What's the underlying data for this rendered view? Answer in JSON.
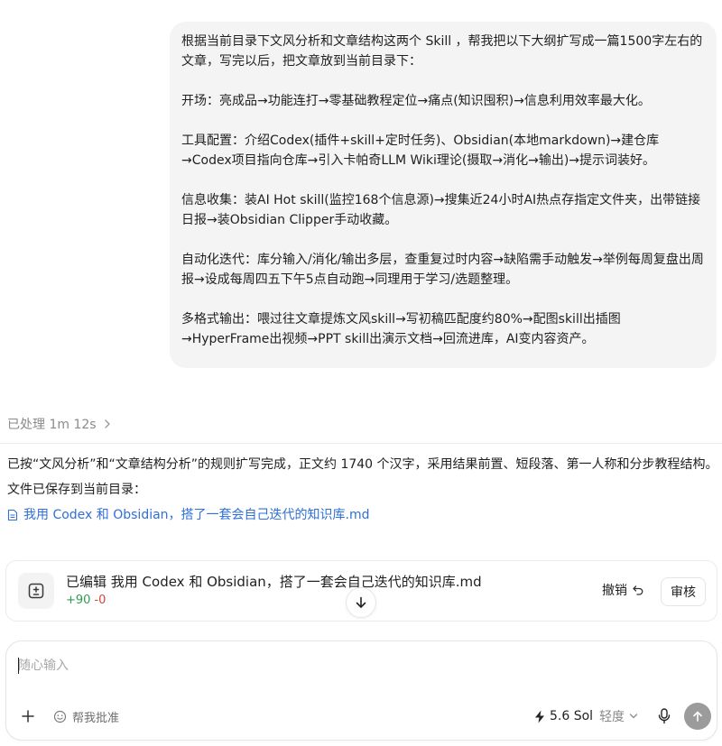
{
  "user_message": {
    "paragraphs": [
      "根据当前目录下文风分析和文章结构这两个 Skill ，帮我把以下大纲扩写成一篇1500字左右的文章，写完以后，把文章放到当前目录下：",
      "开场：亮成品→功能连打→零基础教程定位→痛点(知识囤积)→信息利用效率最大化。",
      "工具配置：介绍Codex(插件+skill+定时任务)、Obsidian(本地markdown)→建仓库→Codex项目指向仓库→引入卡帕奇LLM Wiki理论(摄取→消化→输出)→提示词装好。",
      "信息收集：装AI Hot skill(监控168个信息源)→搜集近24小时AI热点存指定文件夹，出带链接日报→装Obsidian Clipper手动收藏。",
      "自动化迭代：库分输入/消化/输出多层，查重复过时内容→缺陷需手动触发→举例每周复盘出周报→设成每周四五下午5点自动跑→同理用于学习/选题整理。",
      "多格式输出：喂过往文章提炼文风skill→写初稿匹配度约80%→配图skill出插图→HyperFrame出视频→PPT skill出演示文档→回流进库，AI变内容资产。"
    ]
  },
  "processing": {
    "label": "已处理 1m 12s"
  },
  "assistant_reply": {
    "summary": "已按“文风分析”和“文章结构分析”的规则扩写完成，正文约 1740 个汉字，采用结果前置、短段落、第一人称和分步教程结构。",
    "saved_note": "文件已保存到当前目录：",
    "file_name": "我用 Codex 和 Obsidian，搭了一套会自己迭代的知识库.md"
  },
  "edit_card": {
    "title": "已编辑 我用 Codex 和 Obsidian，搭了一套会自己迭代的知识库.md",
    "additions": "+90",
    "deletions": "-0",
    "undo_label": "撤销",
    "review_label": "审核"
  },
  "composer": {
    "placeholder": "随心输入",
    "approve_label": "帮我批准",
    "model_label": "5.6 Sol",
    "effort_label": "轻度"
  },
  "icons": {
    "processing_chevron": "chevron-right-icon",
    "file": "document-icon",
    "edit_card": "diff-icon",
    "undo": "undo-icon",
    "scroll": "arrow-down-icon",
    "plus": "plus-icon",
    "approve": "smile-icon",
    "model": "bolt-icon",
    "model_chevron": "chevron-down-icon",
    "mic": "microphone-icon",
    "send": "arrow-up-icon"
  },
  "colors": {
    "bubble_bg": "#f4f4f4",
    "link": "#2f6fd6",
    "additions": "#2e9d4f",
    "deletions": "#d2453c",
    "send_button": "#9b9b9b"
  }
}
